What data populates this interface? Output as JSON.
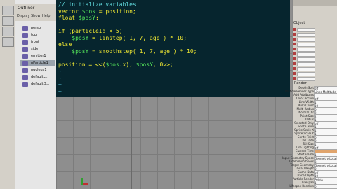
{
  "editor": {
    "lines": [
      {
        "parts": [
          {
            "t": "// initialize variables",
            "c": "c-comment"
          }
        ]
      },
      {
        "parts": [
          {
            "t": "vector ",
            "c": "c-kw"
          },
          {
            "t": "$pos",
            "c": "c-var"
          },
          {
            "t": " = position;",
            "c": "c-kw"
          }
        ]
      },
      {
        "parts": [
          {
            "t": "float ",
            "c": "c-kw"
          },
          {
            "t": "$posY",
            "c": "c-var"
          },
          {
            "t": ";",
            "c": "c-kw"
          }
        ]
      },
      {
        "parts": [
          {
            "t": "",
            "c": "c-kw"
          }
        ]
      },
      {
        "parts": [
          {
            "t": "if (particleId < 5)",
            "c": "c-kw"
          }
        ]
      },
      {
        "parts": [
          {
            "t": "    ",
            "c": "c-kw"
          },
          {
            "t": "$posY",
            "c": "c-var"
          },
          {
            "t": " = linstep( 1, 7, age ) * 10;",
            "c": "c-kw"
          }
        ]
      },
      {
        "parts": [
          {
            "t": "else",
            "c": "c-kw"
          }
        ]
      },
      {
        "parts": [
          {
            "t": "    ",
            "c": "c-kw"
          },
          {
            "t": "$posY",
            "c": "c-var"
          },
          {
            "t": " = smoothstep( 1, 7, age ) * 10;",
            "c": "c-kw"
          }
        ]
      },
      {
        "parts": [
          {
            "t": "",
            "c": "c-kw"
          }
        ]
      },
      {
        "parts": [
          {
            "t": "position = <<(",
            "c": "c-kw"
          },
          {
            "t": "$pos",
            "c": "c-var"
          },
          {
            "t": ".x), ",
            "c": "c-kw"
          },
          {
            "t": "$posY",
            "c": "c-var"
          },
          {
            "t": ", 0>>;",
            "c": "c-kw"
          }
        ]
      },
      {
        "parts": [
          {
            "t": "~",
            "c": "c-tilde"
          }
        ]
      },
      {
        "parts": [
          {
            "t": "~",
            "c": "c-tilde"
          }
        ]
      },
      {
        "parts": [
          {
            "t": "~",
            "c": "c-tilde"
          }
        ]
      },
      {
        "parts": [
          {
            "t": "~",
            "c": "c-tilde"
          }
        ]
      }
    ]
  },
  "outliner": {
    "title": "Outliner",
    "tabs": [
      "Display",
      "Show",
      "Help"
    ],
    "items": [
      "persp",
      "top",
      "front",
      "side",
      "emitter1",
      "nParticle1",
      "nucleus1",
      "defaultL...",
      "defaultO..."
    ],
    "selected_index": 5
  },
  "attributes": {
    "object_label": "Object",
    "section": "Render",
    "rows": [
      {
        "k": "Depth Sort",
        "v": "off"
      },
      {
        "k": "Particle Render Type",
        "v": "Lines Multitude"
      },
      {
        "k": "Add Attributes",
        "v": ""
      },
      {
        "k": "Color Accum",
        "v": "off"
      },
      {
        "k": "Line Width",
        "v": "1"
      },
      {
        "k": "Multi Count",
        "v": "10"
      },
      {
        "k": "Multi Radius",
        "v": "0"
      },
      {
        "k": "Normal Dir",
        "v": "2"
      },
      {
        "k": "Point Size",
        "v": "2"
      },
      {
        "k": "Radius",
        "v": "1"
      },
      {
        "k": "Selected Only",
        "v": "off"
      },
      {
        "k": "Sprite Num",
        "v": "1"
      },
      {
        "k": "Sprite Scale X",
        "v": "1"
      },
      {
        "k": "Sprite Scale Y",
        "v": "1"
      },
      {
        "k": "Sprite Twist",
        "v": "0"
      },
      {
        "k": "Tail Fade",
        "v": "0"
      },
      {
        "k": "Tail Size",
        "v": "1"
      },
      {
        "k": "Use Lighting",
        "v": "off"
      },
      {
        "k": "Current Time",
        "v": "",
        "orange": true
      },
      {
        "k": "Start Frame",
        "v": "1"
      },
      {
        "k": "Input Geometry Space",
        "v": "Geometry Local"
      },
      {
        "k": "Goal Smoothness",
        "v": "3"
      },
      {
        "k": "Target Geometry",
        "v": "Geometry Local"
      },
      {
        "k": "Goal Weight",
        "v": "0"
      },
      {
        "k": "Cache Data",
        "v": "off"
      },
      {
        "k": "Trace Depth",
        "v": "10"
      },
      {
        "k": "Particle Render",
        "v": "Points"
      },
      {
        "k": "Lifespan",
        "v": "1"
      },
      {
        "k": "Lifespan Random",
        "v": "0"
      }
    ]
  }
}
